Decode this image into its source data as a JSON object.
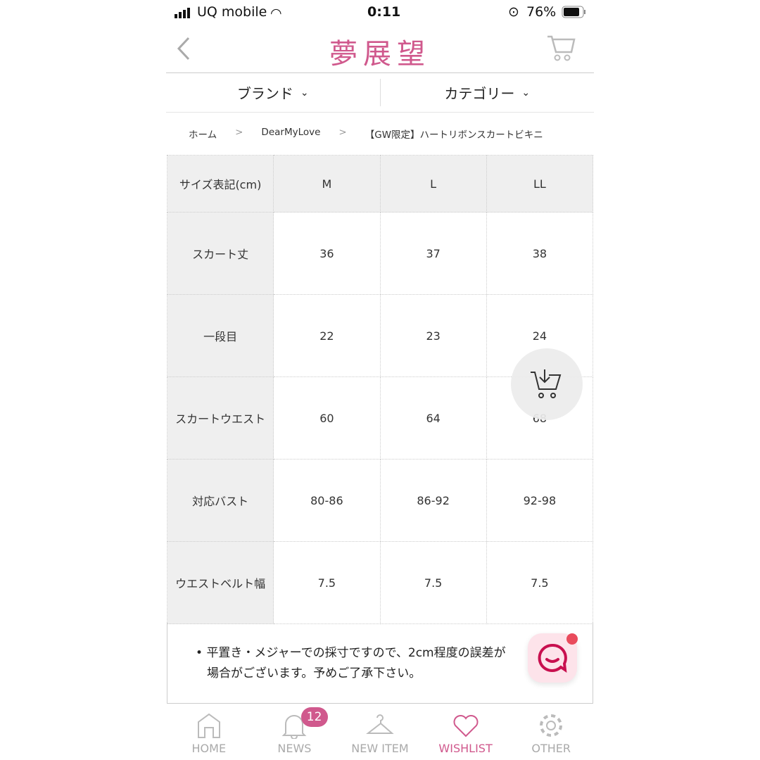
{
  "status": {
    "carrier": "UQ mobile",
    "time": "0:11",
    "battery": "76%"
  },
  "header": {
    "logo": "夢展望"
  },
  "menu": {
    "brand": "ブランド",
    "category": "カテゴリー"
  },
  "breadcrumb": [
    "ホーム",
    "DearMyLove",
    "【GW限定】ハートリボンスカートビキニ"
  ],
  "table": {
    "header": [
      "サイズ表記(cm)",
      "M",
      "L",
      "LL"
    ],
    "rows": [
      [
        "スカート丈",
        "36",
        "37",
        "38"
      ],
      [
        "一段目",
        "22",
        "23",
        "24"
      ],
      [
        "スカートウエスト",
        "60",
        "64",
        "68"
      ],
      [
        "対応バスト",
        "80-86",
        "86-92",
        "92-98"
      ],
      [
        "ウエストベルト幅",
        "7.5",
        "7.5",
        "7.5"
      ]
    ]
  },
  "note": {
    "line1": "平置き・メジャーでの採寸ですので、2cm程度の誤差が",
    "line2": "場合がございます。予めご了承下さい。"
  },
  "nav": {
    "items": [
      {
        "label": "HOME"
      },
      {
        "label": "NEWS",
        "badge": "12"
      },
      {
        "label": "NEW ITEM"
      },
      {
        "label": "WISHLIST",
        "active": true
      },
      {
        "label": "OTHER"
      }
    ]
  },
  "colors": {
    "accent": "#d0598d",
    "inactive": "#aaaaaa"
  }
}
